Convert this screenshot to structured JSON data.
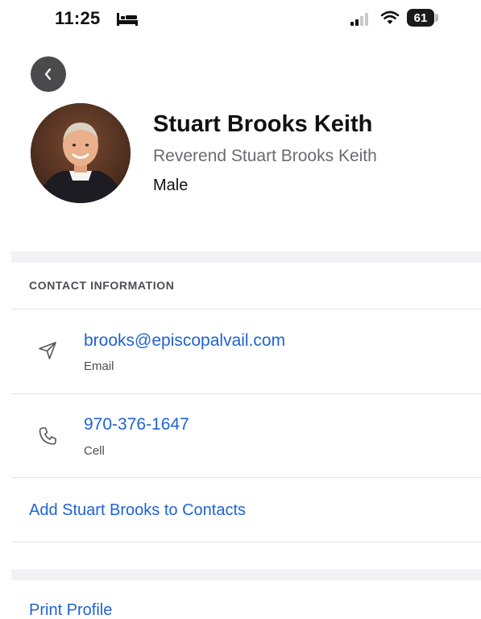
{
  "status_bar": {
    "time": "11:25",
    "battery_level": "61",
    "icons": [
      "bed-icon",
      "signal-icon",
      "wifi-icon",
      "battery-icon"
    ]
  },
  "nav": {
    "back_icon": "chevron-left-icon"
  },
  "profile": {
    "name": "Stuart Brooks Keith",
    "title": "Reverend Stuart Brooks Keith",
    "gender": "Male"
  },
  "contact_section": {
    "header": "CONTACT INFORMATION",
    "items": [
      {
        "value": "brooks@episcopalvail.com",
        "label": "Email",
        "icon": "send-icon"
      },
      {
        "value": "970-376-1647",
        "label": "Cell",
        "icon": "phone-icon"
      }
    ],
    "add_contact_label": "Add Stuart Brooks to Contacts"
  },
  "print_profile_label": "Print Profile",
  "colors": {
    "link": "#1f63d3",
    "secondary_text": "#6b6b70",
    "back_button_bg": "#4a4a4c",
    "separator": "#f2f2f4"
  }
}
